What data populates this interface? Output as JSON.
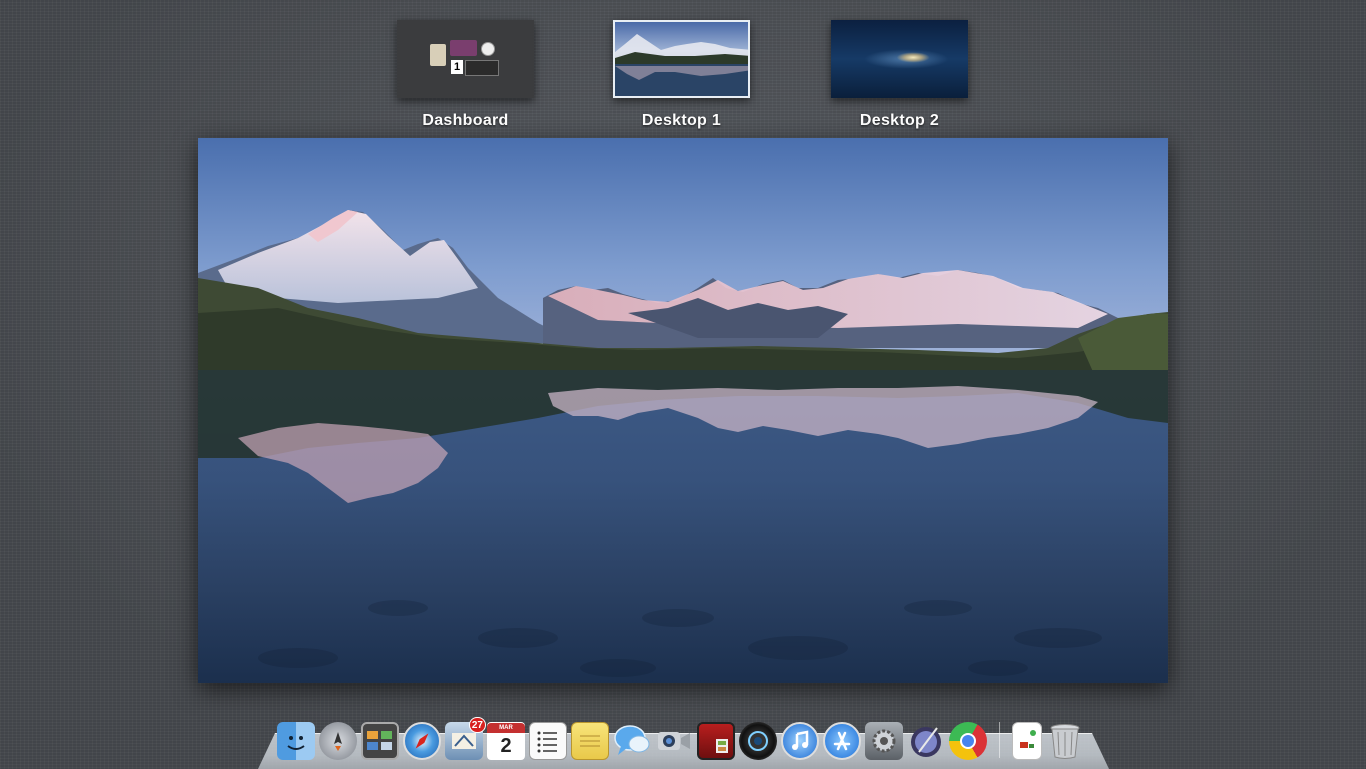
{
  "spaces": [
    {
      "label": "Dashboard",
      "active": false
    },
    {
      "label": "Desktop 1",
      "active": true
    },
    {
      "label": "Desktop 2",
      "active": false
    }
  ],
  "dashboard_thumb": {
    "date_number": "1"
  },
  "dock": {
    "items": [
      {
        "name": "finder-icon"
      },
      {
        "name": "launchpad-icon"
      },
      {
        "name": "mission-control-icon"
      },
      {
        "name": "safari-icon"
      },
      {
        "name": "mail-icon",
        "badge": "27"
      },
      {
        "name": "calendar-icon",
        "month": "MAR",
        "day": "2"
      },
      {
        "name": "reminders-icon"
      },
      {
        "name": "notes-icon"
      },
      {
        "name": "messages-icon"
      },
      {
        "name": "facetime-icon"
      },
      {
        "name": "photo-booth-icon"
      },
      {
        "name": "aperture-icon"
      },
      {
        "name": "itunes-icon"
      },
      {
        "name": "app-store-icon"
      },
      {
        "name": "system-preferences-icon"
      },
      {
        "name": "preview-icon"
      },
      {
        "name": "chrome-icon"
      },
      {
        "name": "documents-stack-icon"
      },
      {
        "name": "trash-icon"
      }
    ]
  },
  "colors": {
    "background": "#4d5156",
    "sky_top": "#4a6fae",
    "water_deep": "#1b2f4d",
    "badge_red": "#d8201f"
  }
}
